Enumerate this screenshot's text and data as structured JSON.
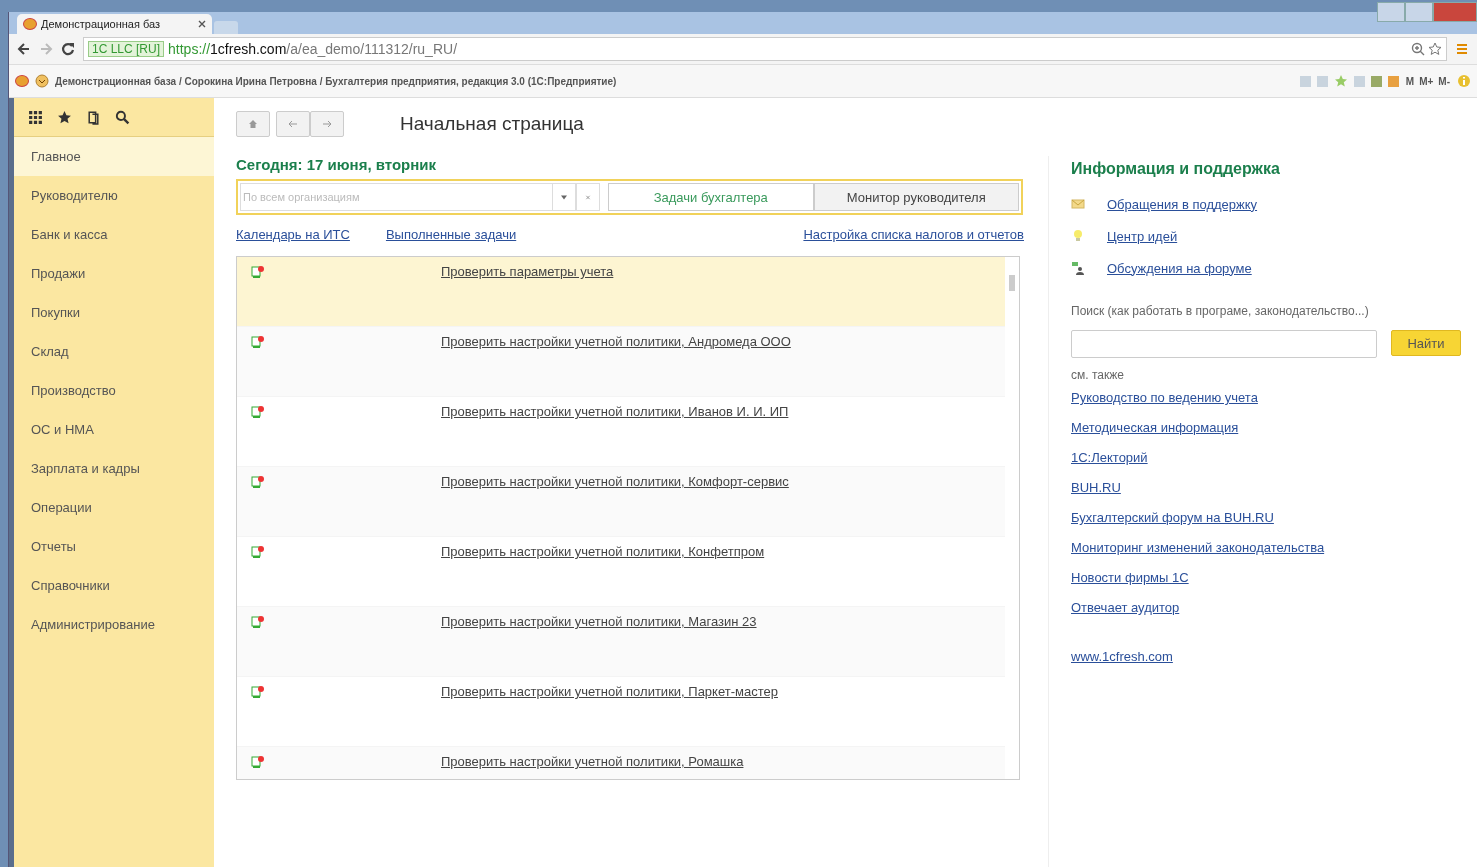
{
  "browser": {
    "tab_title": "Демонстрационная баз",
    "security_label": "1C LLC [RU]",
    "url_scheme": "https://",
    "url_host": "1cfresh.com",
    "url_path": "/a/ea_demo/111312/ru_RU/"
  },
  "app_bar": {
    "title": "Демонстрационная база / Сорокина Ирина Петровна / Бухгалтерия предприятия, редакция 3.0 (1С:Предприятие)",
    "memory_buttons": [
      "M",
      "M+",
      "M-"
    ]
  },
  "sidebar": {
    "items": [
      {
        "label": "Главное",
        "selected": true
      },
      {
        "label": "Руководителю",
        "selected": false
      },
      {
        "label": "Банк и касса",
        "selected": false
      },
      {
        "label": "Продажи",
        "selected": false
      },
      {
        "label": "Покупки",
        "selected": false
      },
      {
        "label": "Склад",
        "selected": false
      },
      {
        "label": "Производство",
        "selected": false
      },
      {
        "label": "ОС и НМА",
        "selected": false
      },
      {
        "label": "Зарплата и кадры",
        "selected": false
      },
      {
        "label": "Операции",
        "selected": false
      },
      {
        "label": "Отчеты",
        "selected": false
      },
      {
        "label": "Справочники",
        "selected": false
      },
      {
        "label": "Администрирование",
        "selected": false
      }
    ]
  },
  "page": {
    "title": "Начальная страница",
    "today": "Сегодня: 17 июня, вторник",
    "org_field": {
      "placeholder": "По всем организациям"
    },
    "tabs": [
      {
        "label": "Задачи бухгалтера",
        "selected": true
      },
      {
        "label": "Монитор руководителя",
        "selected": false
      }
    ],
    "links": [
      "Календарь на ИТС",
      "Выполненные задачи",
      "Настройка списка налогов и отчетов"
    ],
    "tasks": [
      {
        "text": "Проверить параметры учета",
        "selected": true
      },
      {
        "text": "Проверить настройки учетной политики, Андромеда ООО",
        "selected": false
      },
      {
        "text": "Проверить настройки учетной политики, Иванов И. И. ИП",
        "selected": false
      },
      {
        "text": "Проверить настройки учетной политики, Комфорт-сервис",
        "selected": false
      },
      {
        "text": "Проверить настройки учетной политики, Конфетпром",
        "selected": false
      },
      {
        "text": "Проверить настройки учетной политики, Магазин 23",
        "selected": false
      },
      {
        "text": "Проверить настройки учетной политики, Паркет-мастер",
        "selected": false
      },
      {
        "text": "Проверить настройки учетной политики, Ромашка",
        "selected": false
      }
    ]
  },
  "info": {
    "title": "Информация и поддержка",
    "support_links": [
      {
        "kind": "mail",
        "label": "Обращения в поддержку"
      },
      {
        "kind": "idea",
        "label": "Центр идей"
      },
      {
        "kind": "forum",
        "label": "Обсуждения на форуме"
      }
    ],
    "search_label": "Поиск (как работать в програме, законодательство...)",
    "search_button": "Найти",
    "see_also": "см. также",
    "links": [
      "Руководство по ведению учета",
      "Методическая информация",
      "1С:Лекторий",
      "BUH.RU",
      "Бухгалтерский форум на BUH.RU",
      "Мониторинг изменений законодательства",
      "Новости фирмы 1С",
      "Отвечает аудитор"
    ],
    "site_link": "www.1cfresh.com"
  }
}
